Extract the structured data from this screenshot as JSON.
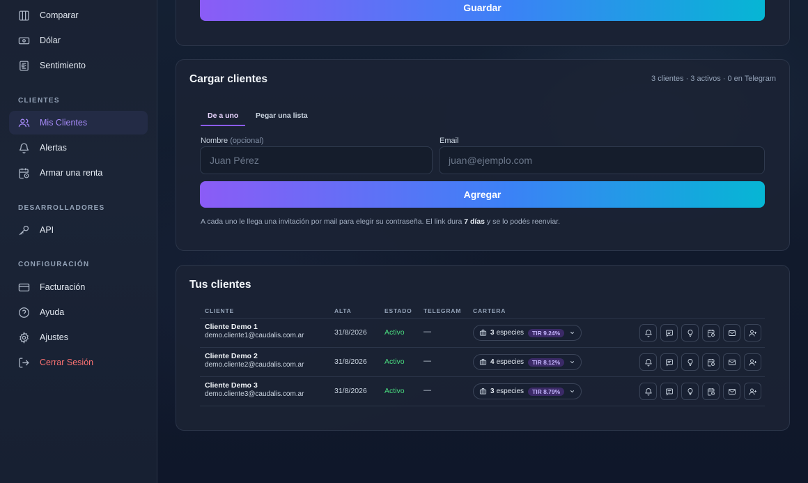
{
  "sidebar": {
    "top_items": [
      {
        "label": "Comparar",
        "icon": "columns-icon"
      },
      {
        "label": "Dólar",
        "icon": "banknote-icon"
      },
      {
        "label": "Sentimiento",
        "icon": "newspaper-icon"
      }
    ],
    "clientes_label": "CLIENTES",
    "clientes_items": [
      {
        "label": "Mis Clientes",
        "icon": "users-icon",
        "active": true
      },
      {
        "label": "Alertas",
        "icon": "bell-icon"
      },
      {
        "label": "Armar una renta",
        "icon": "calendar-clock-icon"
      }
    ],
    "dev_label": "DESARROLLADORES",
    "dev_items": [
      {
        "label": "API",
        "icon": "key-icon"
      }
    ],
    "config_label": "CONFIGURACIÓN",
    "config_items": [
      {
        "label": "Facturación",
        "icon": "credit-card-icon"
      },
      {
        "label": "Ayuda",
        "icon": "help-circle-icon"
      },
      {
        "label": "Ajustes",
        "icon": "gear-icon"
      },
      {
        "label": "Cerrar Sesión",
        "icon": "logout-icon"
      }
    ]
  },
  "top_card": {
    "save_label": "Guardar"
  },
  "cargar": {
    "title": "Cargar clientes",
    "summary": "3 clientes · 3 activos · 0 en Telegram",
    "tabs": [
      "De a uno",
      "Pegar una lista"
    ],
    "active_tab": "De a uno",
    "nombre_label": "Nombre",
    "nombre_optional": "(opcional)",
    "nombre_placeholder": "Juan Pérez",
    "email_label": "Email",
    "email_placeholder": "juan@ejemplo.com",
    "add_label": "Agregar",
    "hint_prefix": "A cada uno le llega una invitación por mail para elegir su contraseña. El link dura ",
    "hint_bold": "7 días",
    "hint_suffix": " y se lo podés reenviar."
  },
  "clientes": {
    "title": "Tus clientes",
    "columns": [
      "CLIENTE",
      "ALTA",
      "ESTADO",
      "TELEGRAM",
      "CARTERA"
    ],
    "rows": [
      {
        "name": "Cliente Demo 1",
        "email": "demo.cliente1@caudalis.com.ar",
        "alta": "31/8/2026",
        "estado": "Activo",
        "telegram": "—",
        "especies_count": "3",
        "especies_label": "especies",
        "tir": "TIR 9.24%"
      },
      {
        "name": "Cliente Demo 2",
        "email": "demo.cliente2@caudalis.com.ar",
        "alta": "31/8/2026",
        "estado": "Activo",
        "telegram": "—",
        "especies_count": "4",
        "especies_label": "especies",
        "tir": "TIR 8.12%"
      },
      {
        "name": "Cliente Demo 3",
        "email": "demo.cliente3@caudalis.com.ar",
        "alta": "31/8/2026",
        "estado": "Activo",
        "telegram": "—",
        "especies_count": "3",
        "especies_label": "especies",
        "tir": "TIR 8.79%"
      }
    ],
    "row_actions": [
      "bell-icon",
      "message-icon",
      "lightbulb-icon",
      "calendar-clock-icon",
      "mail-icon",
      "user-plus-icon"
    ]
  },
  "colors": {
    "accent": "#8b5cf6",
    "gradient_end": "#06b6d4",
    "active_status": "#4ade80",
    "logout": "#f87171"
  }
}
